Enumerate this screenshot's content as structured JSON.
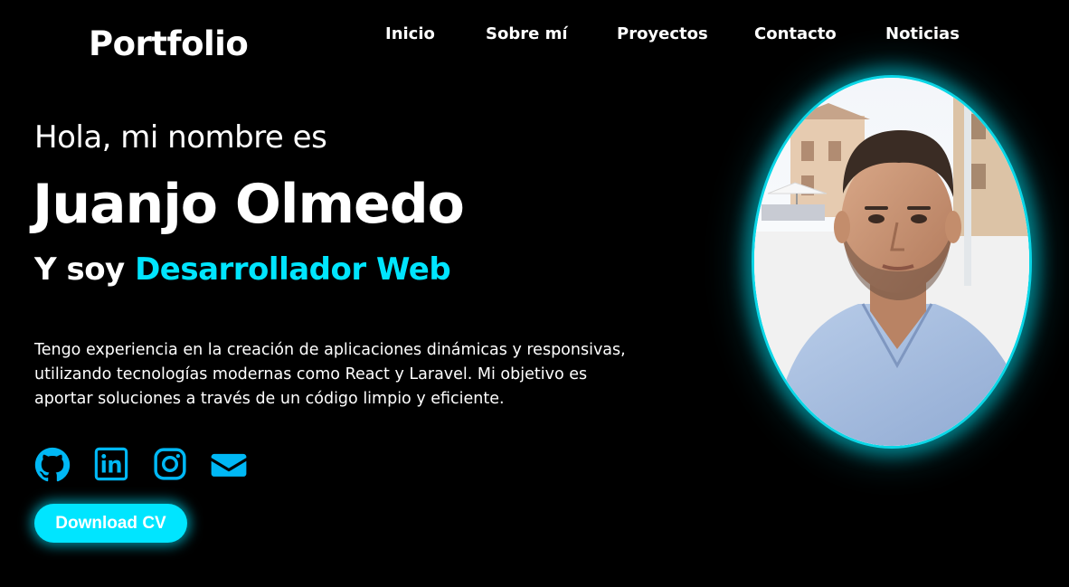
{
  "header": {
    "logo": "Portfolio",
    "nav": [
      "Inicio",
      "Sobre mí",
      "Proyectos",
      "Contacto",
      "Noticias"
    ]
  },
  "hero": {
    "greeting": "Hola, mi nombre es",
    "name": "Juanjo Olmedo",
    "role_prefix": "Y soy",
    "role_highlight": "Desarrollador Web",
    "description": "Tengo experiencia en la creación de aplicaciones dinámicas y responsivas, utilizando tecnologías modernas como React y Laravel. Mi objetivo es aportar soluciones a través de un código limpio y eficiente.",
    "socials": [
      {
        "icon": "github-icon"
      },
      {
        "icon": "linkedin-icon"
      },
      {
        "icon": "instagram-icon"
      },
      {
        "icon": "envelope-icon"
      }
    ],
    "cv_button": "Download CV",
    "photo": "profile-photo"
  },
  "colors": {
    "background": "#000000",
    "text": "#ffffff",
    "accent": "#00e5ff",
    "icon": "#00b8f5"
  }
}
